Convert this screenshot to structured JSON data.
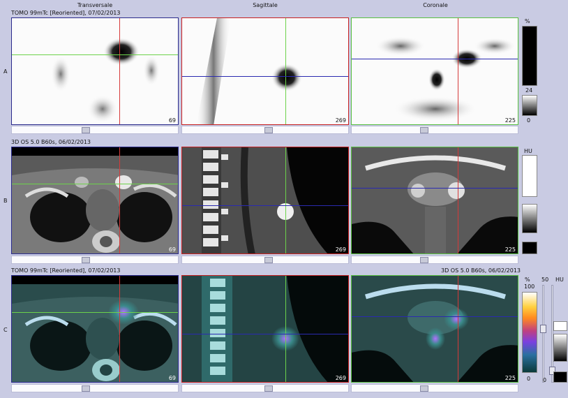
{
  "columns": {
    "transversale": "Transversale",
    "sagittale": "Sagittale",
    "coronale": "Coronale"
  },
  "rows": {
    "a": {
      "letter": "A",
      "header": "TOMO 99mTc [Reoriented], 07/02/2013"
    },
    "b": {
      "letter": "B",
      "header": "3D OS 5.0 B60s, 06/02/2013"
    },
    "c": {
      "letter": "C",
      "header_left": "TOMO 99mTc [Reoriented], 07/02/2013",
      "header_right": "3D OS 5.0 B60s, 06/02/2013"
    }
  },
  "slice_numbers": {
    "transversale": "69",
    "sagittale": "269",
    "coronale": "225"
  },
  "colorbars": {
    "a": {
      "unit": "%",
      "max": "24",
      "min": "0"
    },
    "b": {
      "unit": "HU"
    },
    "c": {
      "pct_unit": "%",
      "pct_max": "100",
      "pct_min": "0",
      "mid_value": "50",
      "hu_unit": "HU",
      "hu_min": "0"
    }
  },
  "colors": {
    "transversale_frame": "#2a2a8c",
    "sagittale_frame": "#c82020",
    "coronale_frame": "#58c040",
    "crosshair_red": "#d63a3a",
    "crosshair_green": "#6cd24a",
    "crosshair_blue": "#2a2ab0"
  }
}
